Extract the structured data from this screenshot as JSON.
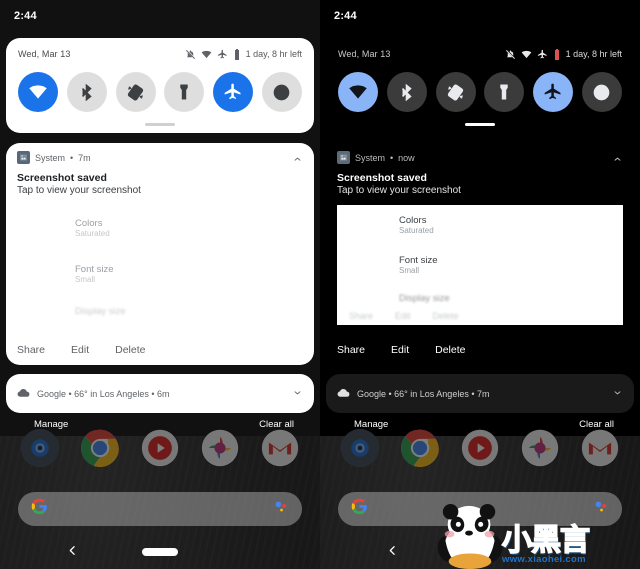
{
  "panels": [
    {
      "id": "light-theme-panel",
      "theme": "light",
      "status_bar": {
        "time": "2:44"
      },
      "quick_settings": {
        "date": "Wed, Mar 13",
        "battery_text": "1 day, 8 hr left",
        "status_icons": [
          "notifications-off-icon",
          "wifi-icon",
          "airplane-icon",
          "battery-icon"
        ],
        "tiles": [
          {
            "name": "wifi-tile",
            "icon": "wifi-icon",
            "active": true
          },
          {
            "name": "bluetooth-tile",
            "icon": "bluetooth-icon",
            "active": false
          },
          {
            "name": "auto-rotate-tile",
            "icon": "auto-rotate-icon",
            "active": false
          },
          {
            "name": "flashlight-tile",
            "icon": "flashlight-icon",
            "active": false
          },
          {
            "name": "airplane-mode-tile",
            "icon": "airplane-icon",
            "active": true
          },
          {
            "name": "do-not-disturb-tile",
            "icon": "do-not-disturb-icon",
            "active": false
          }
        ]
      },
      "notification": {
        "app_icon": "image-icon",
        "source": "System",
        "separator": "•",
        "time": "7m",
        "title": "Screenshot saved",
        "body": "Tap to view your screenshot",
        "expand_icon": "chevron-up-icon",
        "preview": {
          "has_white_card": false,
          "rows": [
            {
              "label": "Colors",
              "value": "Saturated"
            },
            {
              "label": "Font size",
              "value": "Small"
            },
            {
              "label": "Display size",
              "value": "",
              "blurred": true
            }
          ],
          "actions": []
        },
        "actions": [
          "Share",
          "Edit",
          "Delete"
        ]
      },
      "google_notification": {
        "icon": "cloud-icon",
        "text": "Google • 66° in Los Angeles • 6m",
        "expand_icon": "chevron-down-icon"
      },
      "shade_footer": {
        "manage": "Manage",
        "clear_all": "Clear all"
      },
      "dock": [
        {
          "name": "camera-app-icon",
          "label": "Camera"
        },
        {
          "name": "chrome-app-icon",
          "label": "Chrome"
        },
        {
          "name": "youtube-app-icon",
          "label": "YouTube"
        },
        {
          "name": "photos-app-icon",
          "label": "Photos"
        },
        {
          "name": "gmail-app-icon",
          "label": "Gmail"
        }
      ],
      "search_bar": {
        "google_icon": "google-g-icon",
        "assistant_icon": "google-assistant-icon",
        "value": "",
        "placeholder": ""
      },
      "nav_bar": {
        "back_icon": "chevron-left-icon",
        "home_pill": "home-gesture-pill"
      }
    },
    {
      "id": "dark-theme-panel",
      "theme": "dark",
      "status_bar": {
        "time": "2:44"
      },
      "quick_settings": {
        "date": "Wed, Mar 13",
        "battery_text": "1 day, 8 hr left",
        "status_icons": [
          "notifications-off-icon",
          "wifi-icon",
          "airplane-icon",
          "battery-icon"
        ],
        "tiles": [
          {
            "name": "wifi-tile",
            "icon": "wifi-icon",
            "active": true
          },
          {
            "name": "bluetooth-tile",
            "icon": "bluetooth-icon",
            "active": false
          },
          {
            "name": "auto-rotate-tile",
            "icon": "auto-rotate-icon",
            "active": false
          },
          {
            "name": "flashlight-tile",
            "icon": "flashlight-icon",
            "active": false
          },
          {
            "name": "airplane-mode-tile",
            "icon": "airplane-icon",
            "active": true
          },
          {
            "name": "do-not-disturb-tile",
            "icon": "do-not-disturb-icon",
            "active": false
          }
        ]
      },
      "notification": {
        "app_icon": "image-icon",
        "source": "System",
        "separator": "•",
        "time": "now",
        "title": "Screenshot saved",
        "body": "Tap to view your screenshot",
        "expand_icon": "chevron-up-icon",
        "preview": {
          "has_white_card": true,
          "rows": [
            {
              "label": "Colors",
              "value": "Saturated"
            },
            {
              "label": "Font size",
              "value": "Small"
            },
            {
              "label": "Display size",
              "value": "",
              "blurred": true
            }
          ],
          "actions": [
            "Share",
            "Edit",
            "Delete"
          ]
        },
        "actions": [
          "Share",
          "Edit",
          "Delete"
        ]
      },
      "google_notification": {
        "icon": "cloud-icon",
        "text": "Google • 66° in Los Angeles • 7m",
        "expand_icon": "chevron-down-icon"
      },
      "shade_footer": {
        "manage": "Manage",
        "clear_all": "Clear all"
      },
      "dock": [
        {
          "name": "camera-app-icon",
          "label": "Camera"
        },
        {
          "name": "chrome-app-icon",
          "label": "Chrome"
        },
        {
          "name": "youtube-app-icon",
          "label": "YouTube"
        },
        {
          "name": "photos-app-icon",
          "label": "Photos"
        },
        {
          "name": "gmail-app-icon",
          "label": "Gmail"
        }
      ],
      "search_bar": {
        "google_icon": "google-g-icon",
        "assistant_icon": "google-assistant-icon",
        "value": "",
        "placeholder": ""
      },
      "nav_bar": {
        "back_icon": "chevron-left-icon",
        "home_pill": "home-gesture-pill"
      }
    }
  ],
  "watermark": {
    "chinese_text": "小黑言",
    "sub_text": "游戏",
    "url": "www.xiaohei.com",
    "logo": "panda-logo",
    "accent": "#4fc3f7"
  },
  "colors": {
    "light_accent": "#1a73e8",
    "dark_accent": "#8ab4f8",
    "light_card": "#ffffff",
    "dark_card": "#000000",
    "battery_warning": "#d9534f"
  }
}
